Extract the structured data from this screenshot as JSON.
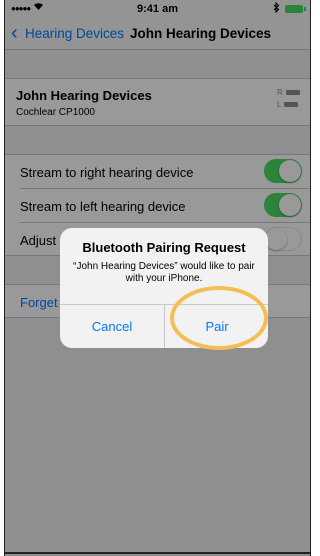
{
  "status_bar": {
    "signal": "●●●●●",
    "wifi_icon": "wifi-icon",
    "time": "9:41 am",
    "bluetooth_icon": "bluetooth-icon",
    "battery_icon": "battery-icon"
  },
  "nav": {
    "back_label": "Hearing Devices",
    "title": "John Hearing Devices"
  },
  "device": {
    "name": "John Hearing Devices",
    "model": "Cochlear CP1000",
    "right_label": "R",
    "left_label": "L"
  },
  "settings": {
    "rows": [
      {
        "label": "Stream to right hearing device",
        "toggle": "on"
      },
      {
        "label": "Stream to left hearing device",
        "toggle": "on"
      },
      {
        "label": "Adjust",
        "toggle": "off"
      }
    ]
  },
  "forget": {
    "label": "Forget"
  },
  "alert": {
    "title": "Bluetooth Pairing Request",
    "message": "“John Hearing Devices” would like to pair with your iPhone.",
    "cancel_label": "Cancel",
    "pair_label": "Pair"
  },
  "colors": {
    "accent": "#007aff",
    "toggle_on": "#4cd964",
    "highlight": "#f5be55"
  }
}
